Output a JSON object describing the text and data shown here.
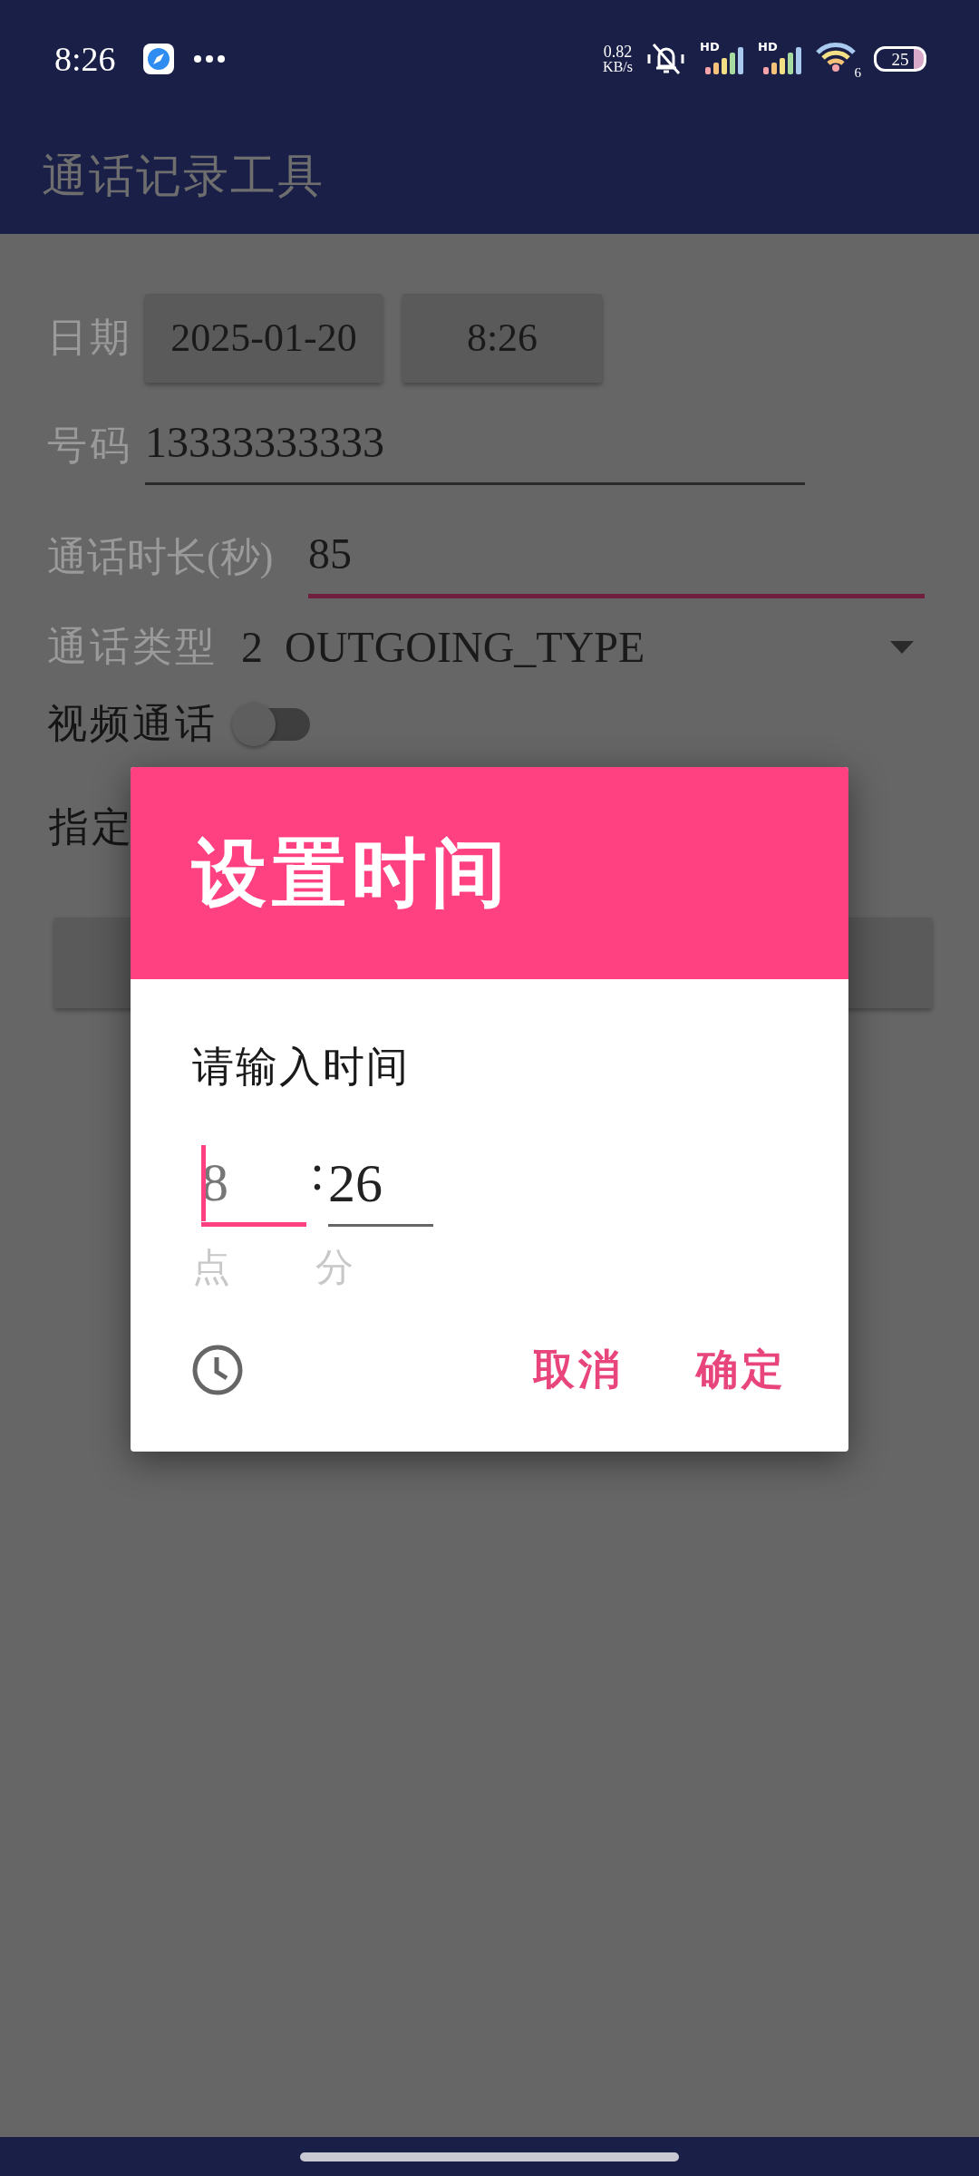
{
  "status_bar": {
    "time": "8:26",
    "net_speed": "0.82",
    "net_unit": "KB/s",
    "sim1": "HD",
    "sim2": "HD",
    "wifi_number": "6",
    "battery": "25"
  },
  "app_bar": {
    "title": "通话记录工具"
  },
  "form": {
    "date_label": "日期",
    "date_value": "2025-01-20",
    "time_value": "8:26",
    "number_label": "号码",
    "number_value": "13333333333",
    "duration_label": "通话时长(秒)",
    "duration_value": "85",
    "duration_focused": true,
    "type_label": "通话类型",
    "type_value": "2  OUTGOING_TYPE",
    "video_label": "视频通话",
    "video_on": false,
    "assign_label": "指定"
  },
  "dialog": {
    "title": "设置时间",
    "prompt": "请输入时间",
    "hour": {
      "placeholder": "8",
      "focused": true
    },
    "separator": ":",
    "minute": {
      "value": "26",
      "focused": false
    },
    "hour_unit": "点",
    "minute_unit": "分",
    "buttons": [
      "取消",
      "确定"
    ]
  }
}
